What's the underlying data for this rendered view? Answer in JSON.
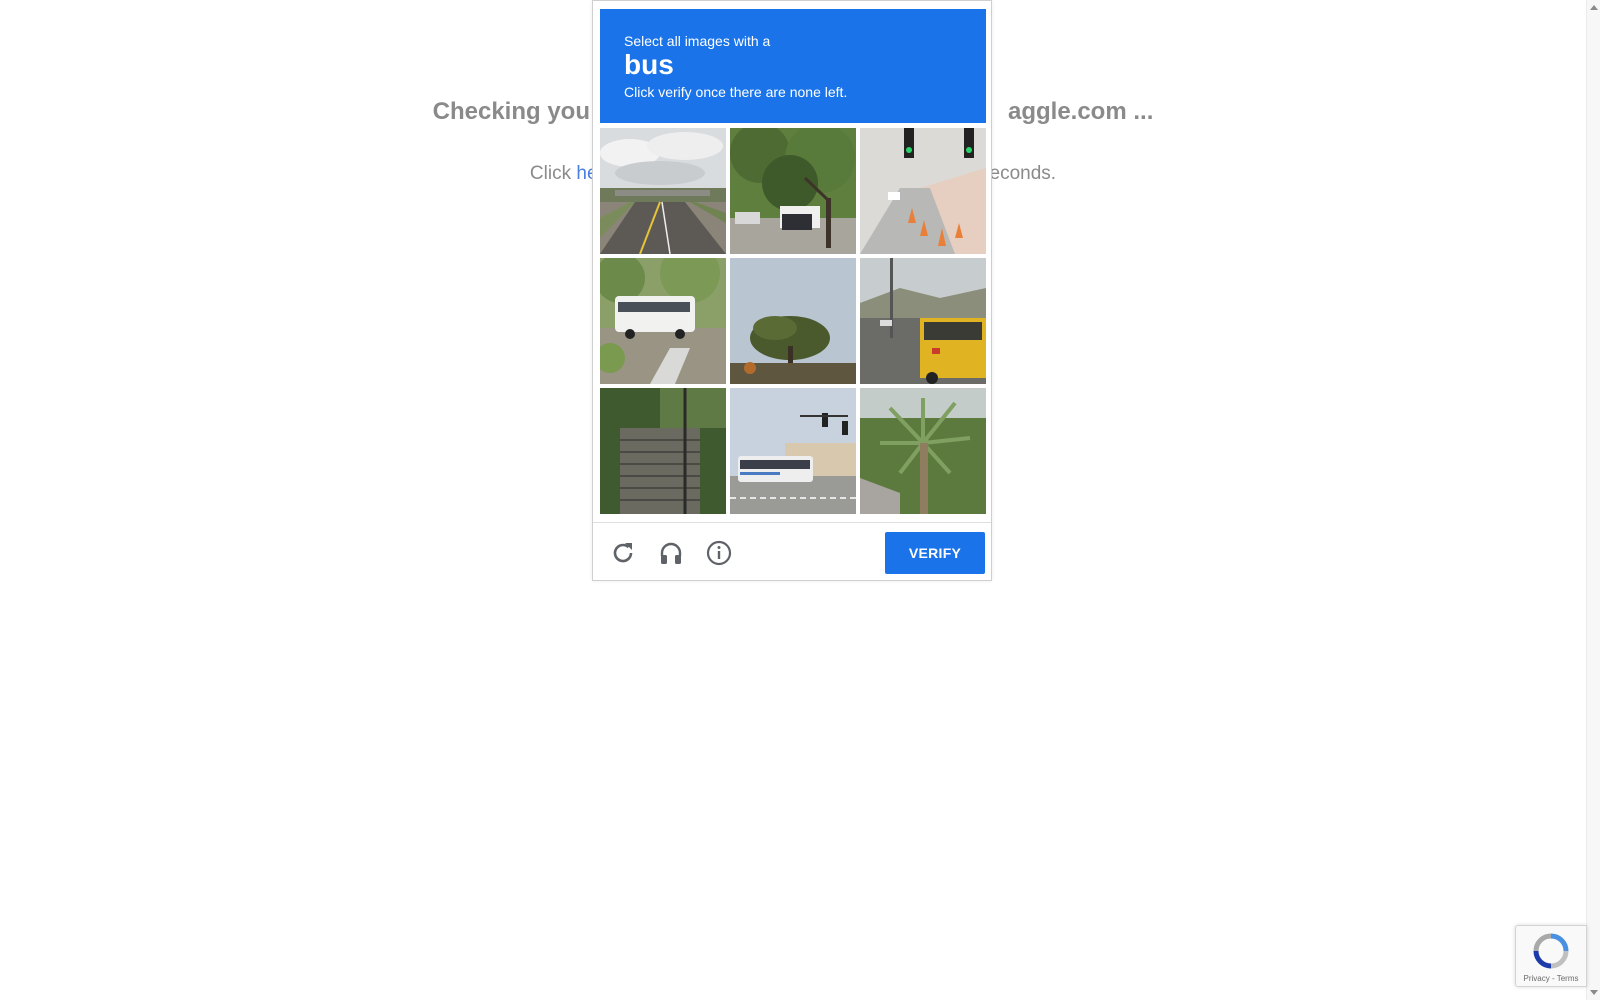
{
  "background": {
    "heading_left": "Checking you",
    "heading_right": "aggle.com ...",
    "sub_prefix": "Click ",
    "sub_link": "he",
    "sub_suffix": "econds."
  },
  "captcha": {
    "instruction": "Select all images with a",
    "object": "bus",
    "note": "Click verify once there are none left.",
    "accent_color": "#1a73e8",
    "tiles": [
      {
        "label": "highway-overpass"
      },
      {
        "label": "tree-and-truck"
      },
      {
        "label": "traffic-lights-cones"
      },
      {
        "label": "white-shuttle-bus"
      },
      {
        "label": "tree-sky"
      },
      {
        "label": "yellow-school-bus"
      },
      {
        "label": "stairs"
      },
      {
        "label": "city-bus-street"
      },
      {
        "label": "palm-tree"
      }
    ],
    "footer": {
      "reload_icon": "reload-icon",
      "audio_icon": "headphones-icon",
      "info_icon": "info-icon",
      "verify_label": "VERIFY"
    }
  },
  "badge": {
    "privacy": "Privacy",
    "separator": " - ",
    "terms": "Terms"
  }
}
